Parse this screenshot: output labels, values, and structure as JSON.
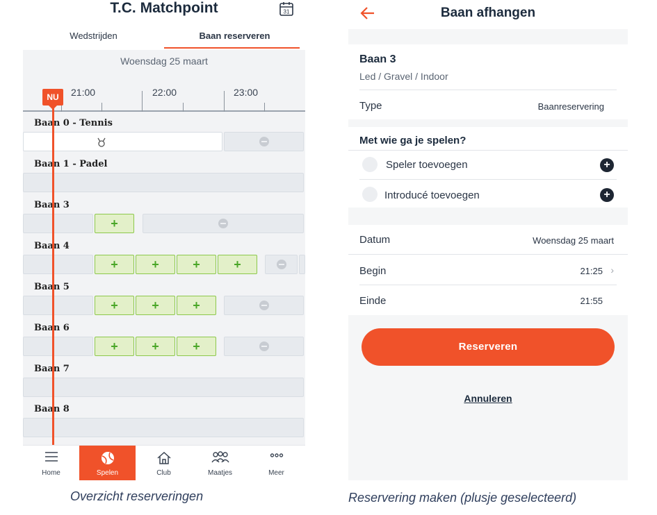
{
  "left": {
    "app_title": "T.C. Matchpoint",
    "calendar_day": "31",
    "tabs": [
      {
        "label": "Wedstrijden",
        "active": false
      },
      {
        "label": "Baan reserveren",
        "active": true
      }
    ],
    "date": "Woensdag 25 maart",
    "now_badge": "NU",
    "times": [
      "21:00",
      "22:00",
      "23:00"
    ],
    "courts": [
      {
        "label": "Baan 0 - Tennis"
      },
      {
        "label": "Baan 1 - Padel"
      },
      {
        "label": "Baan 3"
      },
      {
        "label": "Baan 4"
      },
      {
        "label": "Baan 5"
      },
      {
        "label": "Baan 6"
      },
      {
        "label": "Baan 7"
      },
      {
        "label": "Baan 8"
      }
    ],
    "slot_symbol": "+",
    "nav": [
      {
        "label": "Home",
        "icon": "menu-icon",
        "active": false
      },
      {
        "label": "Spelen",
        "icon": "tennis-ball-icon",
        "active": true
      },
      {
        "label": "Club",
        "icon": "house-icon",
        "active": false
      },
      {
        "label": "Maatjes",
        "icon": "people-icon",
        "active": false
      },
      {
        "label": "Meer",
        "icon": "more-icon",
        "active": false
      }
    ],
    "caption": "Overzicht reserveringen"
  },
  "right": {
    "title": "Baan afhangen",
    "court_name": "Baan 3",
    "court_details": "Led / Gravel / Indoor",
    "type_label": "Type",
    "type_value": "Baanreservering",
    "players_title": "Met wie ga je spelen?",
    "add_player": "Speler toevoegen",
    "add_guest": "Introducé toevoegen",
    "date_label": "Datum",
    "date_value": "Woensdag 25 maart",
    "begin_label": "Begin",
    "begin_value": "21:25",
    "end_label": "Einde",
    "end_value": "21:55",
    "reserve_button": "Reserveren",
    "cancel_link": "Annuleren",
    "caption": "Reservering maken (plusje geselecteerd)"
  },
  "colors": {
    "accent": "#f0522a",
    "slot_green_bg": "#e3f0c9",
    "slot_green_border": "#8cc84b",
    "dark": "#1c2b3d"
  }
}
